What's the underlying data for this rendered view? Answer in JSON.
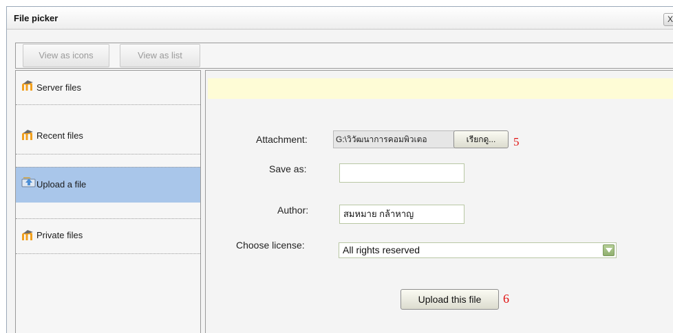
{
  "dialog": {
    "title": "File picker",
    "close_label": "X"
  },
  "toolbar": {
    "view_icons_label": "View as icons",
    "view_list_label": "View as list"
  },
  "sidebar": {
    "items": [
      {
        "label": "Server files",
        "icon": "moodle-icon"
      },
      {
        "label": "Recent files",
        "icon": "moodle-icon"
      },
      {
        "label": "Upload a file",
        "icon": "upload-icon",
        "active": true
      },
      {
        "label": "Private files",
        "icon": "moodle-icon"
      }
    ]
  },
  "form": {
    "attachment_label": "Attachment:",
    "attachment_value": "G:\\วิวัฒนาการคอมพิวเตอ",
    "browse_label": "เรียกดู...",
    "save_as_label": "Save as:",
    "save_as_value": "",
    "author_label": "Author:",
    "author_value": "สมหมาย กล้าหาญ",
    "license_label": "Choose license:",
    "license_value": "All rights reserved",
    "upload_label": "Upload this file"
  },
  "annotations": {
    "step_browse": "5",
    "step_upload": "6"
  },
  "colors": {
    "active_item": "#a9c6ea",
    "notice_bg": "#fefcd6",
    "annotation_red": "#e01010"
  }
}
